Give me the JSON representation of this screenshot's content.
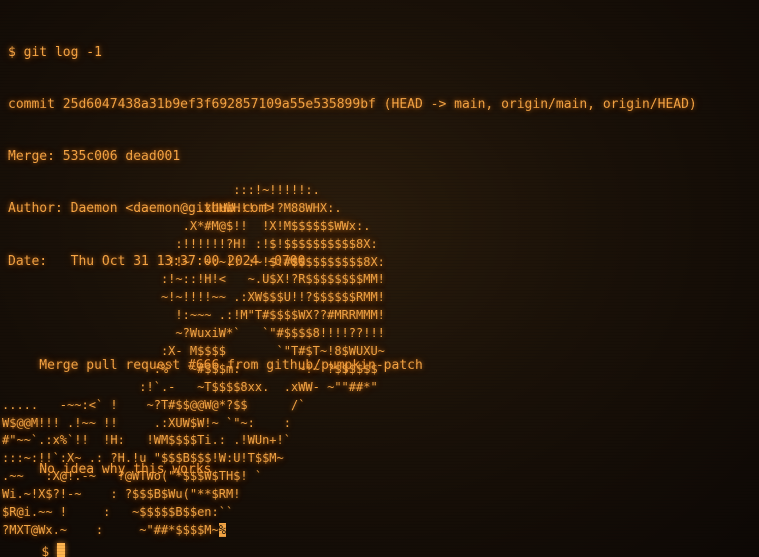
{
  "terminal": {
    "command": "$ git log -1",
    "commit_line": "commit 25d6047438a31b9ef3f692857109a55e535899bf (HEAD -> main, origin/main, origin/HEAD)",
    "merge_line": "Merge: 535c006 dead001",
    "author_line": "Author: Daemon <daemon@github.com>",
    "date_line": "Date:   Thu Oct 31 13:37:00 2024 -0700",
    "message_title": "    Merge pull request #666 from github/pumpkin-patch",
    "message_body": "    No idea why this works",
    "prompt_symbol": "$",
    "cursor_label": "cursor",
    "ascii_art": [
      "                                :::!~!!!!!:.",
      "                           .xUHWH!! !!?M88WHX:.",
      "                         .X*#M@$!!  !X!M$$$$$$WWx:.",
      "                        :!!!!!!?H! :!$!$$$$$$$$$$8X:",
      "                       !!~  ~:~!! :~!$!#$$$$$$$$$$8X:",
      "                      :!~::!H!<   ~.U$X!?R$$$$$$$$MM!",
      "                      ~!~!!!!~~ .:XW$$$U!!?$$$$$$RMM!",
      "                        !:~~~ .:!M\"T#$$$$WX??#MRRMMM!",
      "                        ~?WuxiW*`   `\"#$$$$8!!!!??!!!",
      "                      :X- M$$$$       `\"T#$T~!8$WUXU~",
      "                     :%`  ~#$$$m:        ~!~ ?$$$$$$",
      "                   :!`.-   ~T$$$$8xx.  .xWW- ~\"\"##*\"",
      ".....   -~~:<` !    ~?T#$$@@W@*?$$      /`",
      "W$@@M!!! .!~~ !!     .:XUW$W!~ `\"~:    :",
      "#\"~~`.:x%`!!  !H:   !WM$$$$Ti.: .!WUn+!`",
      ":::~:!!`:X~ .: ?H.!u \"$$$B$$$!W:U!T$$M~",
      ".~~   :X@!.-~   ?@WTWo(\"*$$$W$TH$! `",
      "Wi.~!X$?!-~    : ?$$$B$Wu(\"**$RM!",
      "$R@i.~~ !     :   ~$$$$$B$$en:``",
      "?MXT@Wx.~    :     ~\"##*$$$$M~"
    ],
    "ascii_tail_highlight": "%"
  },
  "colors": {
    "text": "#f6a544",
    "background": "#1a1108",
    "cursor": "#ffb54f"
  }
}
